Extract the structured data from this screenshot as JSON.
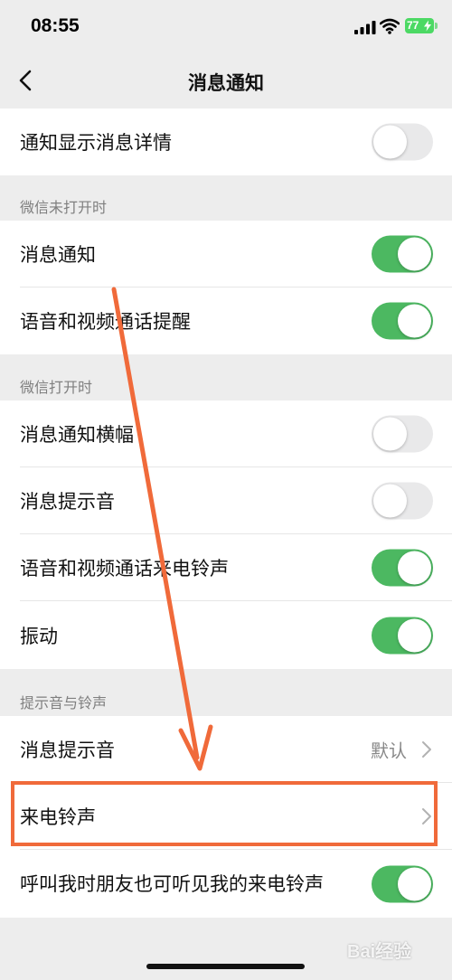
{
  "status_bar": {
    "time": "08:55",
    "battery": "77"
  },
  "nav": {
    "title": "消息通知"
  },
  "rows": {
    "show_details": {
      "label": "通知显示消息详情",
      "toggle": false
    },
    "section_closed": "微信未打开时",
    "msg_notify": {
      "label": "消息通知",
      "toggle": true
    },
    "call_remind": {
      "label": "语音和视频通话提醒",
      "toggle": true
    },
    "section_open": "微信打开时",
    "banner": {
      "label": "消息通知横幅",
      "toggle": false
    },
    "msg_sound": {
      "label": "消息提示音",
      "toggle": false
    },
    "call_ringtone": {
      "label": "语音和视频通话来电铃声",
      "toggle": true
    },
    "vibrate": {
      "label": "振动",
      "toggle": true
    },
    "section_sound": "提示音与铃声",
    "sound_setting": {
      "label": "消息提示音",
      "value": "默认"
    },
    "ringtone": {
      "label": "来电铃声"
    },
    "friends_hear": {
      "label": "呼叫我时朋友也可听见我的来电铃声",
      "toggle": true
    }
  },
  "colors": {
    "toggle_on": "#4cb861",
    "toggle_off": "#e9e9ea",
    "annotation": "#f06a3a"
  },
  "watermark": "Bai经验"
}
